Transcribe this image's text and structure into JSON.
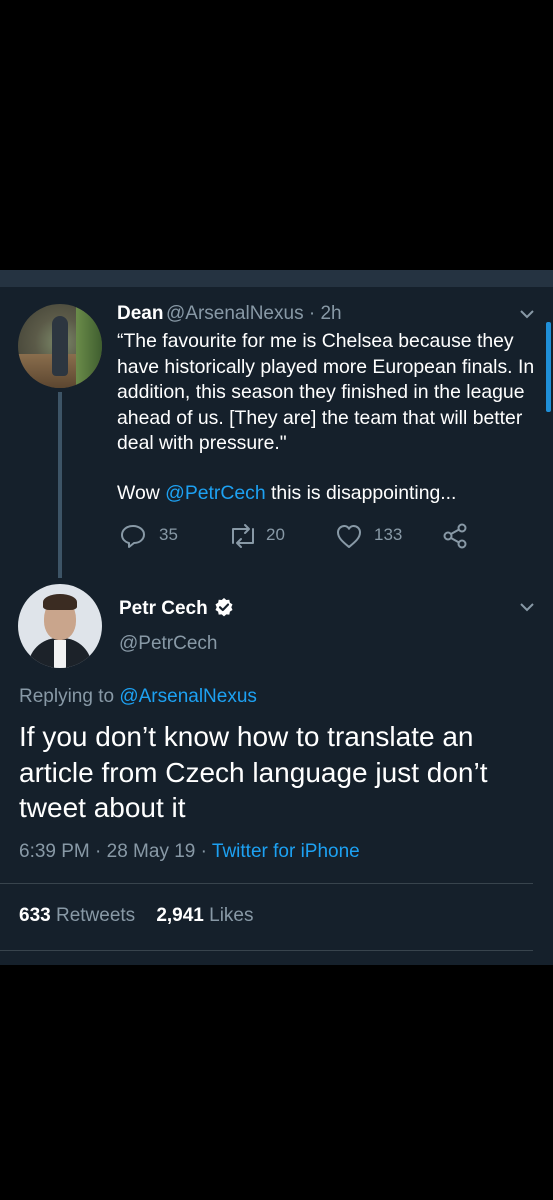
{
  "parent_tweet": {
    "display_name": "Dean",
    "handle_time": "@ArsenalNexus · 2h",
    "text": "“The favourite for me is Chelsea because they\nhave historically played more European finals. In\naddition, this season they finished in the league\nahead of us. [They are] the team that will better\ndeal with pressure.\"",
    "wow_prefix": "Wow ",
    "wow_mention": "@PetrCech",
    "wow_suffix": " this is disappointing...",
    "replies": "35",
    "retweets": "20",
    "likes": "133"
  },
  "main_tweet": {
    "display_name": "Petr Cech",
    "handle": "@PetrCech",
    "replying_prefix": "Replying to ",
    "replying_to": "@ArsenalNexus",
    "text": "If you don’t know how to translate an article from Czech language just don’t tweet about it",
    "timestamp": "6:39 PM · 28 May 19 · ",
    "source": "Twitter for iPhone",
    "retweet_count": "633",
    "retweet_label": " Retweets",
    "like_count": "2,941",
    "like_label": " Likes"
  },
  "colors": {
    "background": "#15202b",
    "accent": "#1da1f2",
    "muted": "#8899a6",
    "divider": "#38444d"
  },
  "icons": [
    "reply-icon",
    "retweet-icon",
    "like-icon",
    "share-icon",
    "chevron-down-icon",
    "verified-icon"
  ]
}
